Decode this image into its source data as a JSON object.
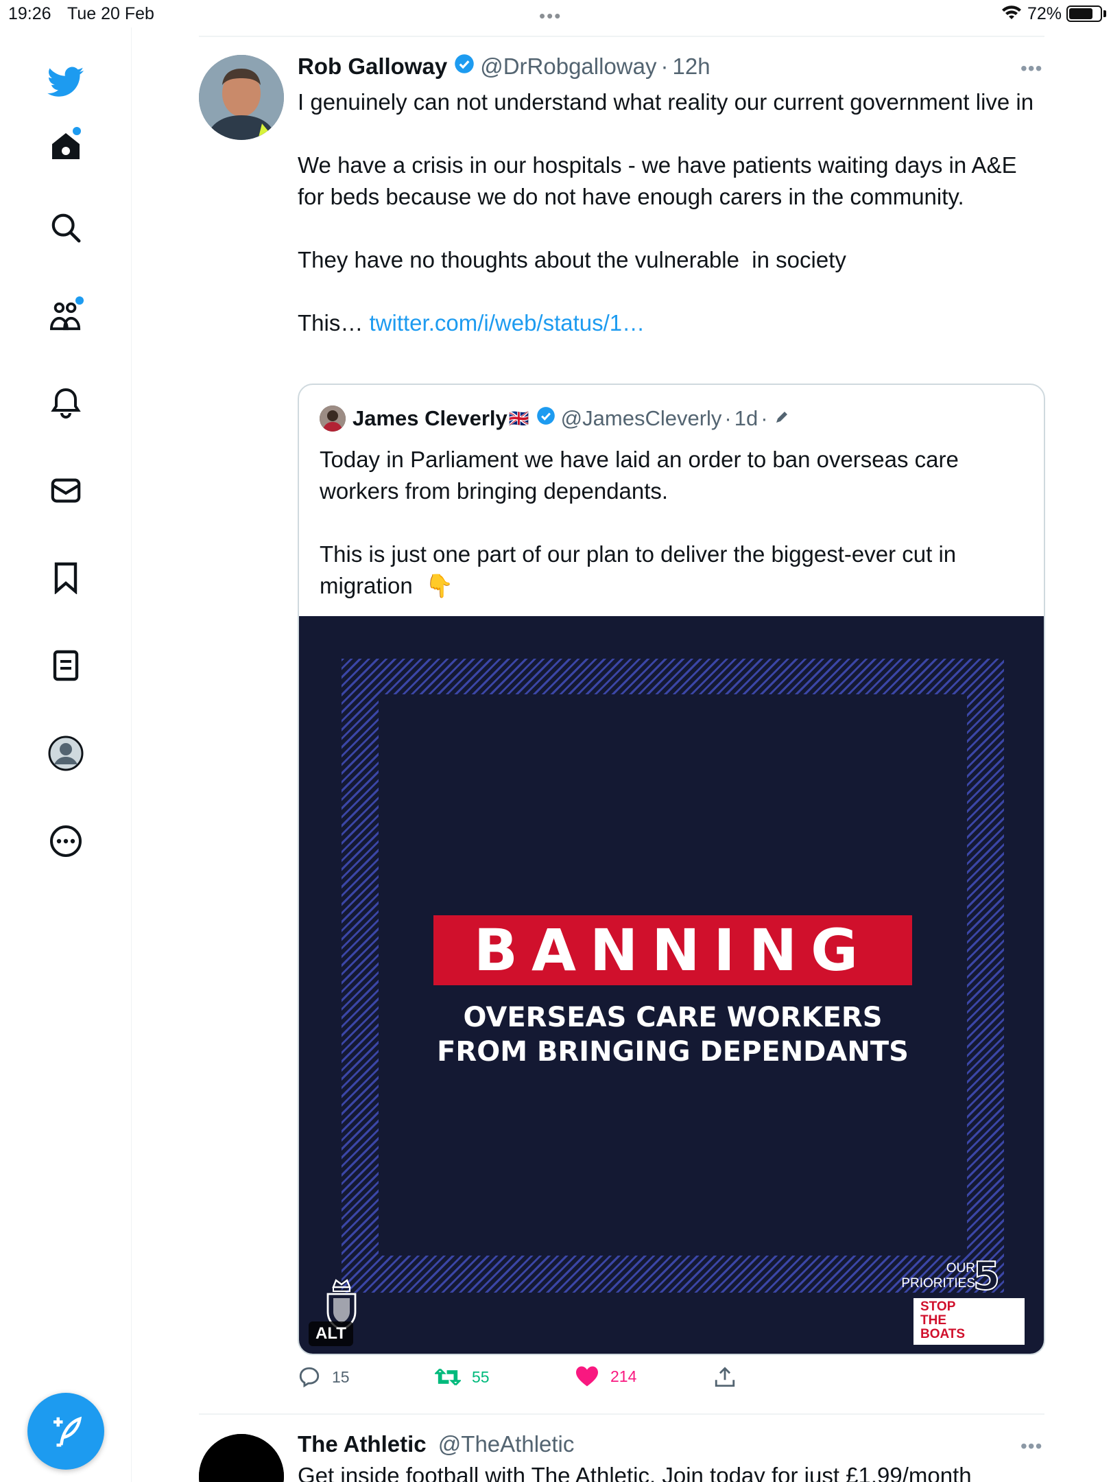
{
  "status_bar": {
    "time": "19:26",
    "date": "Tue 20 Feb",
    "battery": "72%"
  },
  "nav": [
    {
      "name": "home"
    },
    {
      "name": "explore"
    },
    {
      "name": "communities"
    },
    {
      "name": "notifications"
    },
    {
      "name": "messages"
    },
    {
      "name": "bookmarks"
    },
    {
      "name": "lists"
    },
    {
      "name": "profile"
    },
    {
      "name": "more"
    }
  ],
  "tweet": {
    "author": "Rob Galloway",
    "handle": "@DrRobgalloway",
    "time": "12h",
    "text_main": "I genuinely can not understand what reality our current government live in\n\nWe have a crisis in our hospitals - we have patients waiting days in A&E for beds because we do not have enough carers in the community.\n\nThey have no thoughts about the vulnerable  in society\n\nThis… ",
    "link": "twitter.com/i/web/status/1…",
    "quote": {
      "author": "James Cleverly",
      "flag": "🇬🇧",
      "handle": "@JamesCleverly",
      "time": "1d",
      "text": "Today in Parliament we have laid an order to ban overseas care workers from bringing dependants.\n\nThis is just one part of our plan to deliver the biggest-ever cut in migration  👇",
      "image": {
        "banner": "BANNING",
        "subhead_1": "OVERSEAS CARE WORKERS",
        "subhead_2": "FROM BRINGING DEPENDANTS",
        "alt_label": "ALT",
        "priorities_1": "OUR",
        "priorities_2": "PRIORITIES",
        "priorities_number": "5",
        "stop_1": "STOP",
        "stop_2": "THE",
        "stop_3": "BOATS"
      }
    },
    "replies": "15",
    "retweets": "55",
    "likes": "214"
  },
  "next_tweet": {
    "author": "The Athletic",
    "handle": "@TheAthletic",
    "text": "Get inside football with The Athletic. Join today for just £1.99/month"
  },
  "colors": {
    "accent": "#1d9bf0",
    "retweet": "#00ba7c",
    "like": "#f91880",
    "banner_red": "#d0102c",
    "navy": "#141933"
  }
}
